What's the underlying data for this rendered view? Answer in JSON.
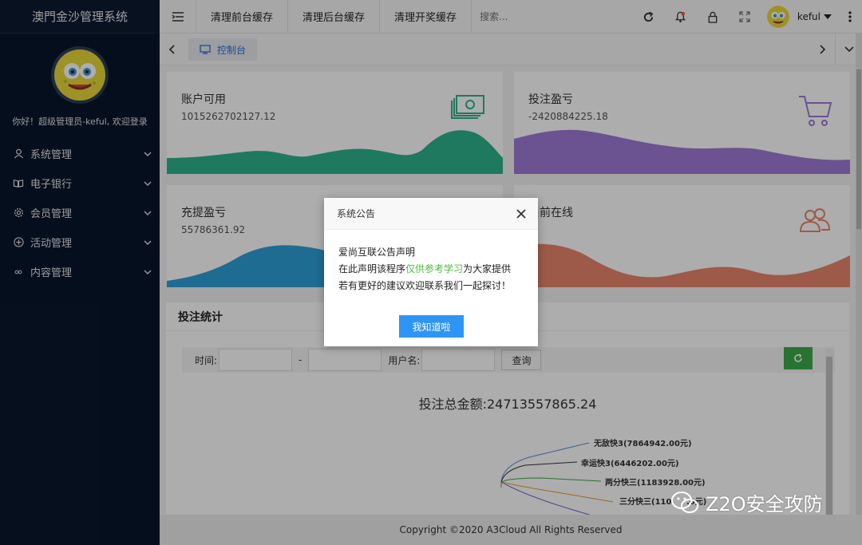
{
  "app": {
    "title": "澳門金沙管理系统"
  },
  "sidebar": {
    "greeting": "你好！超级管理员-keful, 欢迎登录",
    "items": [
      {
        "label": "系统管理",
        "icon": "user-icon"
      },
      {
        "label": "电子银行",
        "icon": "book-icon"
      },
      {
        "label": "会员管理",
        "icon": "gear-icon"
      },
      {
        "label": "活动管理",
        "icon": "plus-circle-icon"
      },
      {
        "label": "内容管理",
        "icon": "link-icon"
      }
    ]
  },
  "header": {
    "buttons": [
      "清理前台缓存",
      "清理后台缓存",
      "清理开奖缓存"
    ],
    "search_placeholder": "搜索...",
    "username": "keful"
  },
  "tabs": {
    "active": "控制台"
  },
  "cards": [
    {
      "title": "账户可用",
      "value": "1015262702127.12",
      "color": "#2db38c",
      "icon": "money-icon"
    },
    {
      "title": "投注盈亏",
      "value": "-2420884225.18",
      "color": "#9c7bd4",
      "icon": "cart-icon"
    },
    {
      "title": "充提盈亏",
      "value": "55786361.92",
      "color": "#2f9fd8",
      "icon": ""
    },
    {
      "title": "当前在线",
      "value": "",
      "color": "#e8856a",
      "icon": "users-icon"
    }
  ],
  "stats": {
    "title": "投注统计",
    "time_label": "时间:",
    "date_separator": "-",
    "username_label": "用户名:",
    "query_button": "查询",
    "total": "投注总金额:24713557865.24",
    "pie_labels": [
      "无敌快3(7864942.00元)",
      "幸运快3(6446202.00元)",
      "两分快三(1183928.00元)",
      "三分快三(110",
      ".0元)"
    ]
  },
  "footer": {
    "text": "Copyright ©2020 A3Cloud All Rights Reserved"
  },
  "dialog": {
    "title": "系统公告",
    "line1": "爱尚互联公告声明",
    "line2_pre": "在此声明该程序",
    "line2_highlight": "仅供参考学习",
    "line2_post": "为大家提供",
    "line3": "若有更好的建议欢迎联系我们一起探讨！",
    "button": "我知道啦"
  },
  "watermark": {
    "text": "Z2O安全攻防"
  }
}
